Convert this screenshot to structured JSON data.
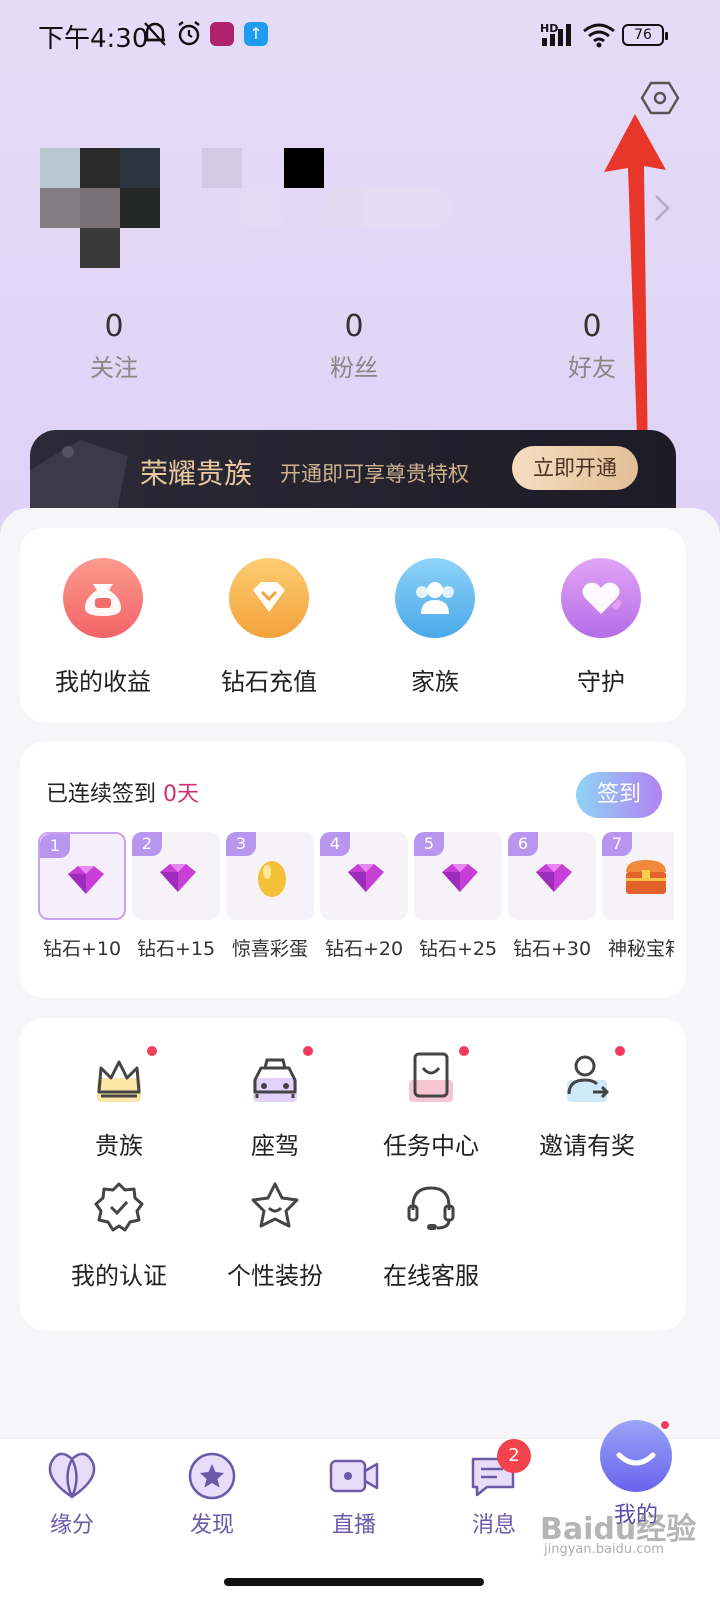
{
  "status_bar": {
    "time": "下午4:30",
    "network": "HD",
    "battery": "76"
  },
  "icons": {
    "settings": "settings-hexagon-icon",
    "chevron": "chevron-right-icon"
  },
  "stats": [
    {
      "value": "0",
      "label": "关注"
    },
    {
      "value": "0",
      "label": "粉丝"
    },
    {
      "value": "0",
      "label": "好友"
    }
  ],
  "vip_banner": {
    "title": "荣耀贵族",
    "description": "开通即可享尊贵特权",
    "button": "立即开通"
  },
  "quick_actions": [
    {
      "label": "我的收益",
      "icon": "money-bag-icon",
      "color": "#f46e6e"
    },
    {
      "label": "钻石充值",
      "icon": "diamond-icon",
      "color": "#f5b14a"
    },
    {
      "label": "家族",
      "icon": "group-icon",
      "color": "#5ab4ef"
    },
    {
      "label": "守护",
      "icon": "heart-icon",
      "color": "#c987ef"
    }
  ],
  "signin": {
    "title": "已连续签到",
    "days": "0天",
    "button": "签到",
    "rewards": [
      {
        "num": "1",
        "label": "钻石+10",
        "reward": "diamond"
      },
      {
        "num": "2",
        "label": "钻石+15",
        "reward": "diamond"
      },
      {
        "num": "3",
        "label": "惊喜彩蛋",
        "reward": "egg"
      },
      {
        "num": "4",
        "label": "钻石+20",
        "reward": "diamond"
      },
      {
        "num": "5",
        "label": "钻石+25",
        "reward": "diamond"
      },
      {
        "num": "6",
        "label": "钻石+30",
        "reward": "diamond"
      },
      {
        "num": "7",
        "label": "神秘宝箱",
        "reward": "chest"
      }
    ]
  },
  "tools": [
    {
      "label": "贵族",
      "icon": "crown-icon",
      "dot": true
    },
    {
      "label": "座驾",
      "icon": "car-icon",
      "dot": true
    },
    {
      "label": "任务中心",
      "icon": "task-icon",
      "dot": true
    },
    {
      "label": "邀请有奖",
      "icon": "invite-user-icon",
      "dot": true
    },
    {
      "label": "我的认证",
      "icon": "verified-badge-icon",
      "dot": false
    },
    {
      "label": "个性装扮",
      "icon": "star-face-icon",
      "dot": false
    },
    {
      "label": "在线客服",
      "icon": "headset-icon",
      "dot": false
    }
  ],
  "bottom_nav": [
    {
      "label": "缘分",
      "icon": "fate-icon"
    },
    {
      "label": "发现",
      "icon": "discover-star-icon"
    },
    {
      "label": "直播",
      "icon": "live-camera-icon"
    },
    {
      "label": "消息",
      "icon": "message-icon",
      "badge": "2"
    },
    {
      "label": "我的",
      "icon": "profile-face-icon",
      "active": true
    }
  ],
  "watermark": {
    "brand": "Baidu经验",
    "url": "jingyan.baidu.com"
  },
  "colors": {
    "accent_purple": "#b896ef",
    "alert_red": "#f43b5c",
    "vip_gold": "#e9c9a0",
    "annotation_arrow": "#e8362a"
  }
}
